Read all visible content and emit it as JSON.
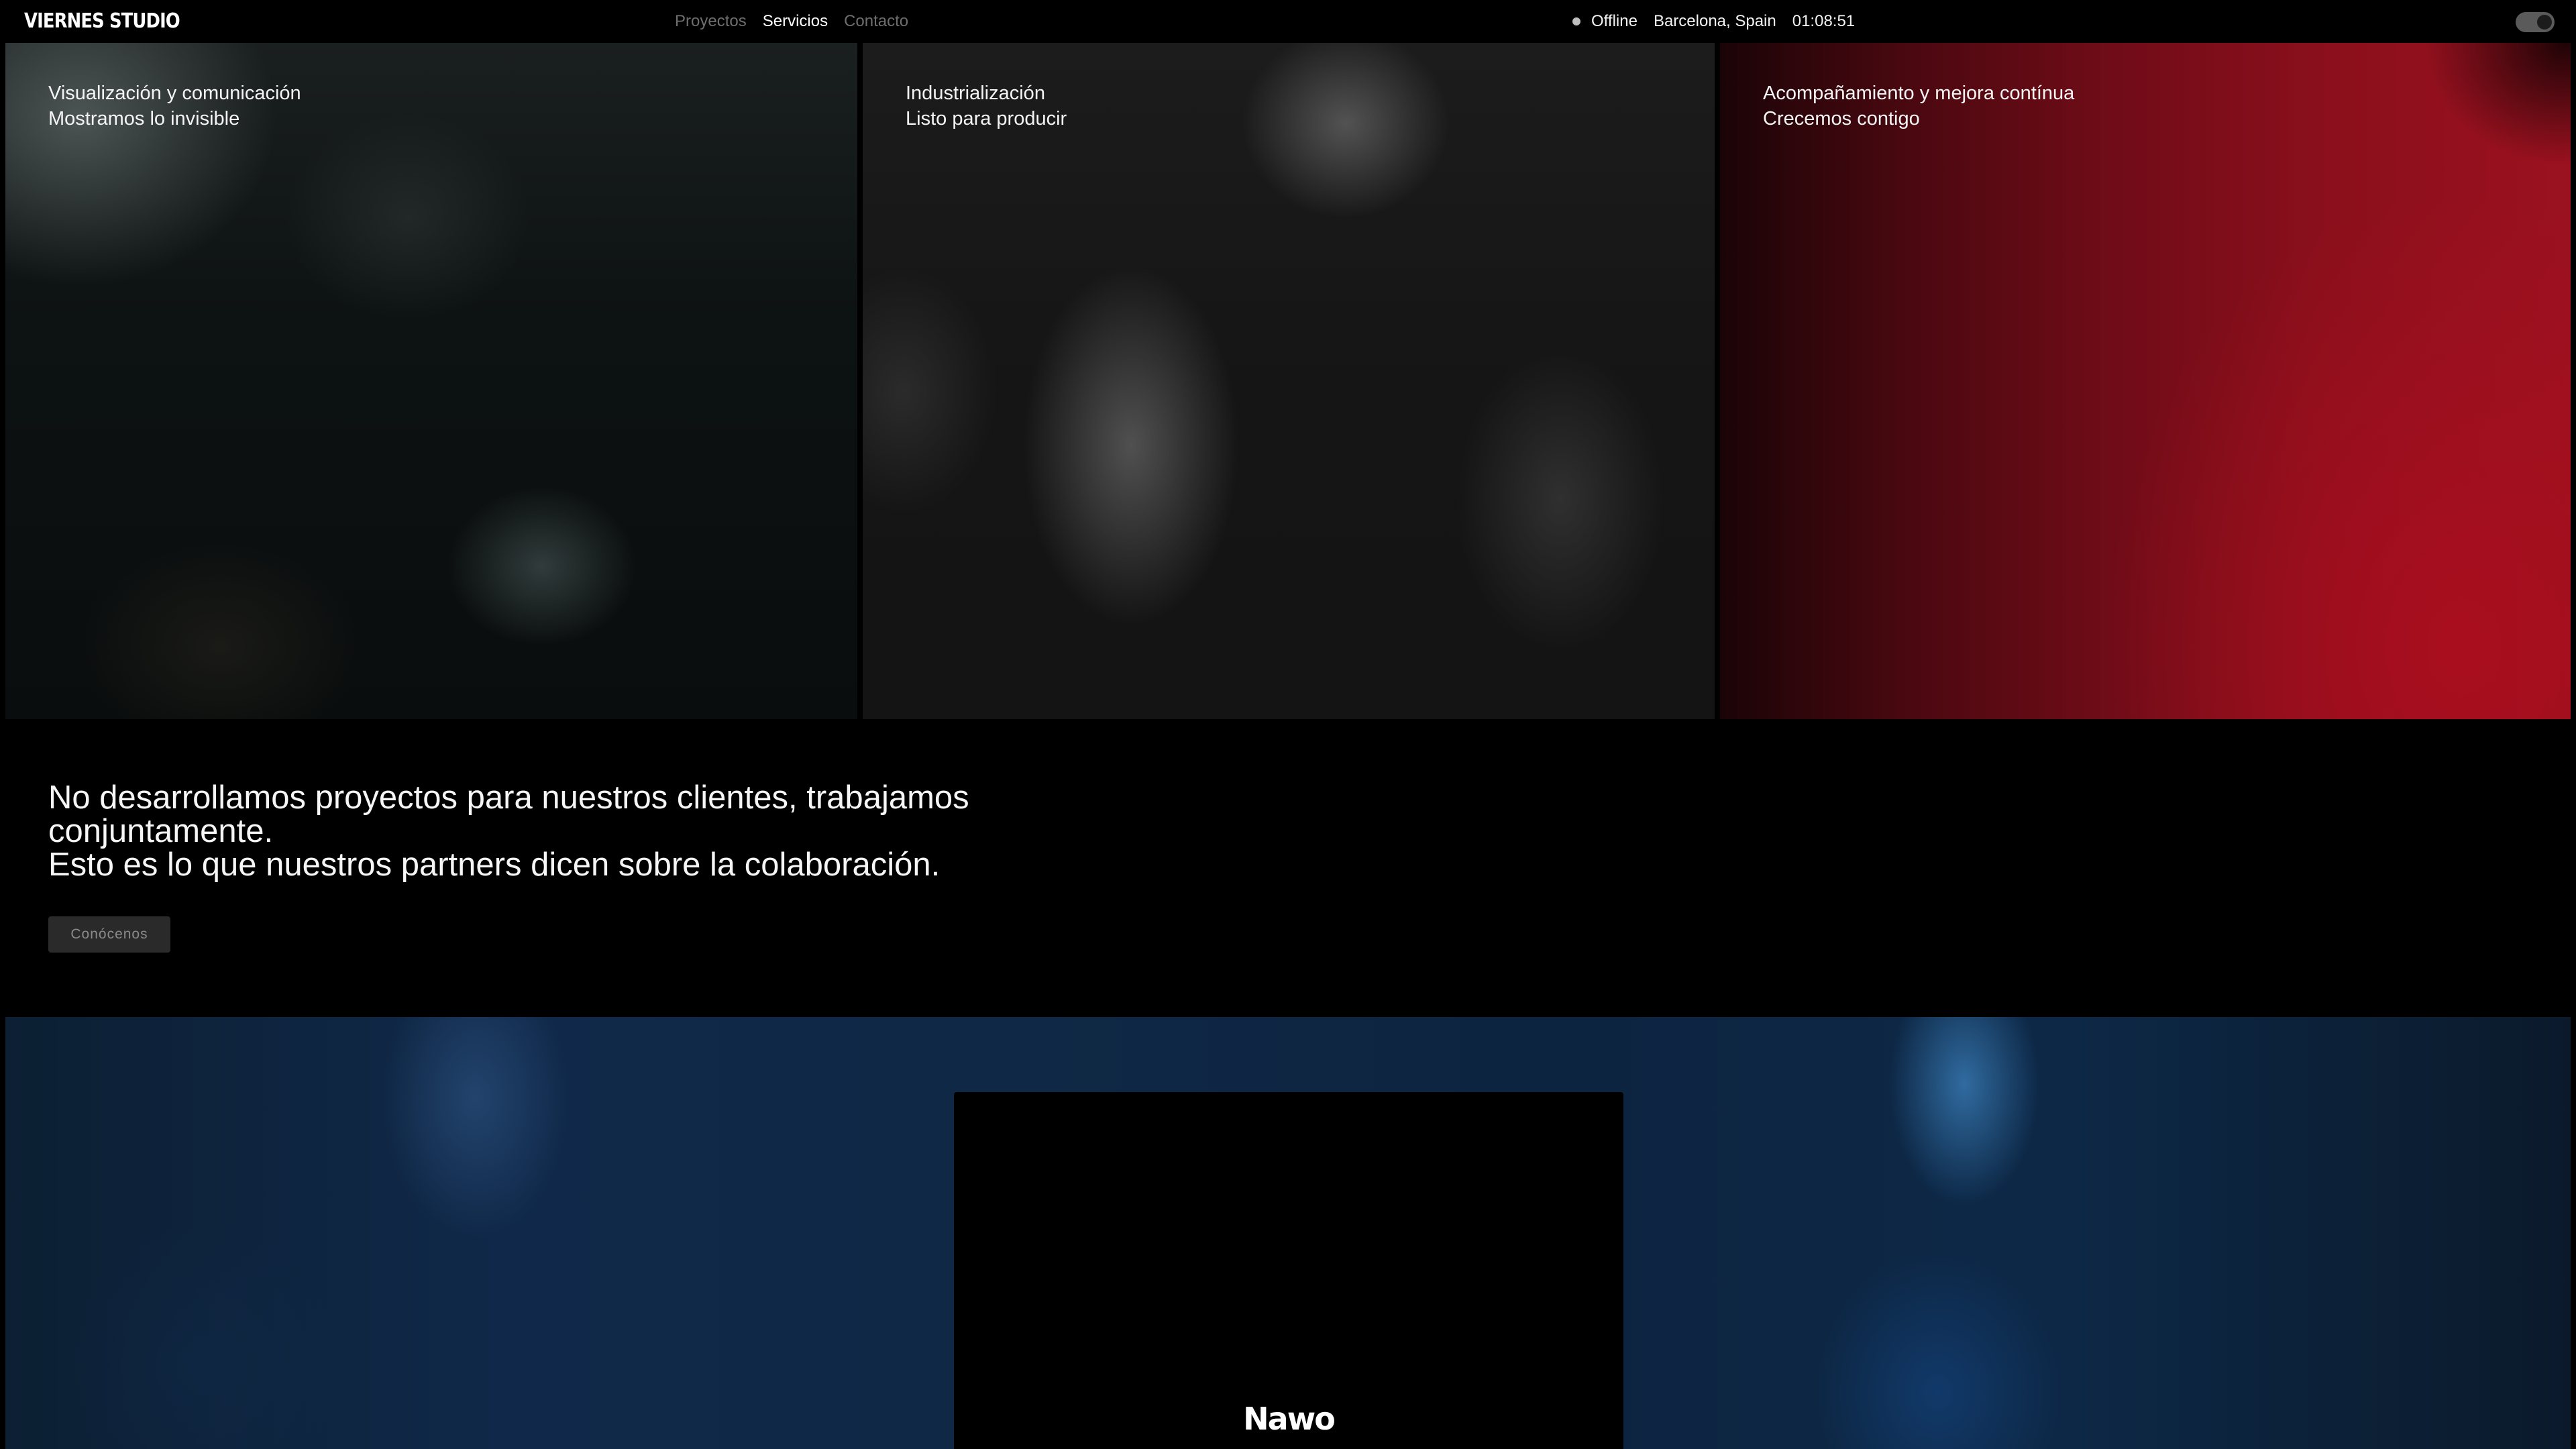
{
  "header": {
    "logo": "VIERNES STUDIO",
    "nav": [
      "Proyectos",
      "Servicios",
      "Contacto"
    ],
    "active_nav": "Servicios",
    "status": {
      "label": "Offline",
      "location": "Barcelona, Spain",
      "time": "01:08:51"
    },
    "theme_toggle_on": true
  },
  "services": [
    {
      "title": "Visualización y comunicación",
      "subtitle": "Mostramos lo invisible"
    },
    {
      "title": "Industrialización",
      "subtitle": "Listo para producir"
    },
    {
      "title": "Acompañamiento y mejora contínua",
      "subtitle": "Crecemos contigo"
    }
  ],
  "statement": {
    "line1": "No desarrollamos proyectos para nuestros clientes, trabajamos conjuntamente.",
    "line2": "Esto es lo que nuestros partners dicen sobre la colaboración.",
    "cta": "Conócenos"
  },
  "showcase": {
    "client": "Nawo"
  },
  "colors": {
    "background": "#000000",
    "accent_red": "#9b111f",
    "accent_blue": "#10294a"
  }
}
